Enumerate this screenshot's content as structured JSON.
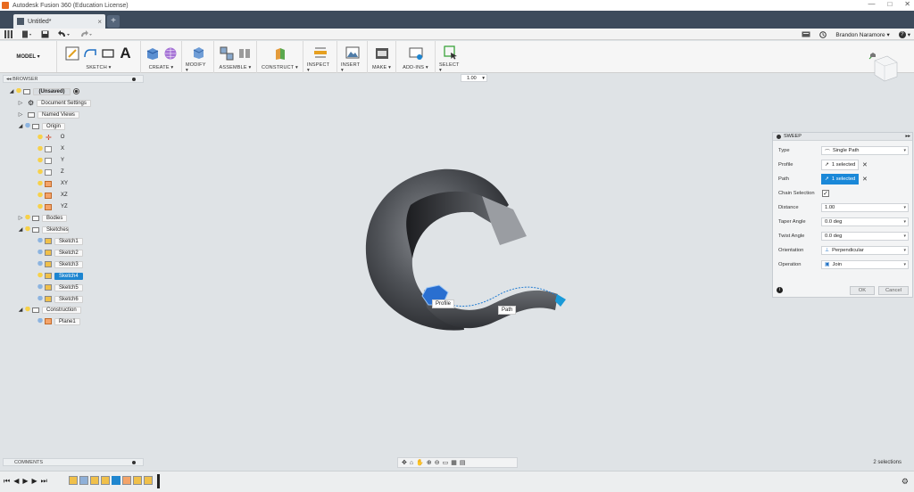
{
  "window": {
    "title": "Autodesk Fusion 360 (Education License)",
    "minimize": "—",
    "maximize": "□",
    "close": "✕"
  },
  "tab": {
    "name": "Untitled*",
    "close": "×",
    "new": "+"
  },
  "quickbar": {
    "user": "Brandon Naramore ▾",
    "help": "?"
  },
  "ribbon": {
    "workspace": "MODEL ▾",
    "groups": [
      {
        "label": "SKETCH ▾"
      },
      {
        "label": "CREATE ▾"
      },
      {
        "label": "MODIFY ▾"
      },
      {
        "label": "ASSEMBLE ▾"
      },
      {
        "label": "CONSTRUCT ▾"
      },
      {
        "label": "INSPECT ▾"
      },
      {
        "label": "INSERT ▾"
      },
      {
        "label": "MAKE ▾"
      },
      {
        "label": "ADD-INS ▾"
      },
      {
        "label": "SELECT ▾"
      }
    ],
    "sketch_text_glyph": "A"
  },
  "zoom": {
    "value": "1.00"
  },
  "browser": {
    "title": "BROWSER",
    "root": "(Unsaved)",
    "items": {
      "document_settings": "Document Settings",
      "named_views": "Named Views",
      "origin": "Origin",
      "o": "O",
      "x": "X",
      "y": "Y",
      "z": "Z",
      "xy": "XY",
      "xz": "XZ",
      "yz": "YZ",
      "bodies": "Bodies",
      "sketches": "Sketches",
      "sketch1": "Sketch1",
      "sketch2": "Sketch2",
      "sketch3": "Sketch3",
      "sketch4": "Sketch4",
      "sketch5": "Sketch5",
      "sketch6": "Sketch6",
      "construction": "Construction",
      "plane1": "Plane1"
    }
  },
  "viewport": {
    "profile_label": "Profile",
    "path_label": "Path"
  },
  "sweep": {
    "title": "SWEEP",
    "type_label": "Type",
    "type_value": "Single Path",
    "profile_label": "Profile",
    "profile_value": "1 selected",
    "path_label": "Path",
    "path_value": "1 selected",
    "chain_label": "Chain Selection",
    "chain_checked": true,
    "distance_label": "Distance",
    "distance_value": "1.00",
    "taper_label": "Taper Angle",
    "taper_value": "0.0 deg",
    "twist_label": "Twist Angle",
    "twist_value": "0.0 deg",
    "orientation_label": "Orientation",
    "orientation_value": "Perpendicular",
    "operation_label": "Operation",
    "operation_value": "Join",
    "ok": "OK",
    "cancel": "Cancel",
    "info": "i"
  },
  "comments": {
    "title": "COMMENTS"
  },
  "status": {
    "selections": "2 selections"
  },
  "colors": {
    "accent": "#1a88d8",
    "tabbar": "#3d4b5c",
    "model": "#4a4d52"
  }
}
